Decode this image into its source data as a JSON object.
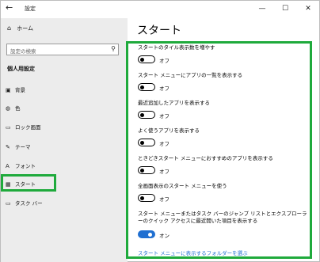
{
  "window": {
    "title": "設定",
    "back_glyph": "←",
    "minimize": "—",
    "maximize": "☐",
    "close": "✕"
  },
  "sidebar": {
    "home_label": "ホーム",
    "search_placeholder": "設定の検索",
    "section_title": "個人用設定",
    "items": [
      {
        "label": "背景",
        "icon": "picture-icon"
      },
      {
        "label": "色",
        "icon": "palette-icon"
      },
      {
        "label": "ロック画面",
        "icon": "lock-screen-icon"
      },
      {
        "label": "テーマ",
        "icon": "brush-icon"
      },
      {
        "label": "フォント",
        "icon": "font-icon"
      },
      {
        "label": "スタート",
        "icon": "start-icon",
        "selected": true
      },
      {
        "label": "タスク バー",
        "icon": "taskbar-icon"
      }
    ]
  },
  "main": {
    "title": "スタート",
    "settings": [
      {
        "label": "スタートのタイル表示数を増やす",
        "state": "オフ",
        "on": false
      },
      {
        "label": "スタート メニューにアプリの一覧を表示する",
        "state": "オフ",
        "on": false
      },
      {
        "label": "最近追加したアプリを表示する",
        "state": "オフ",
        "on": false
      },
      {
        "label": "よく使うアプリを表示する",
        "state": "オフ",
        "on": false
      },
      {
        "label": "ときどきスタート メニューにおすすめのアプリを表示する",
        "state": "オフ",
        "on": false
      },
      {
        "label": "全画面表示のスタート メニューを使う",
        "state": "オフ",
        "on": false
      },
      {
        "label": "スタート メニューまたはタスク バーのジャンプ リストとエクスプローラーのクイック アクセスに最近開いた項目を表示する",
        "state": "オン",
        "on": true
      }
    ],
    "link": "スタート メニューに表示するフォルダーを選ぶ"
  },
  "colors": {
    "highlight": "#1faa3c",
    "accent": "#1f6fd1",
    "sidebar_bg": "#ececec"
  }
}
